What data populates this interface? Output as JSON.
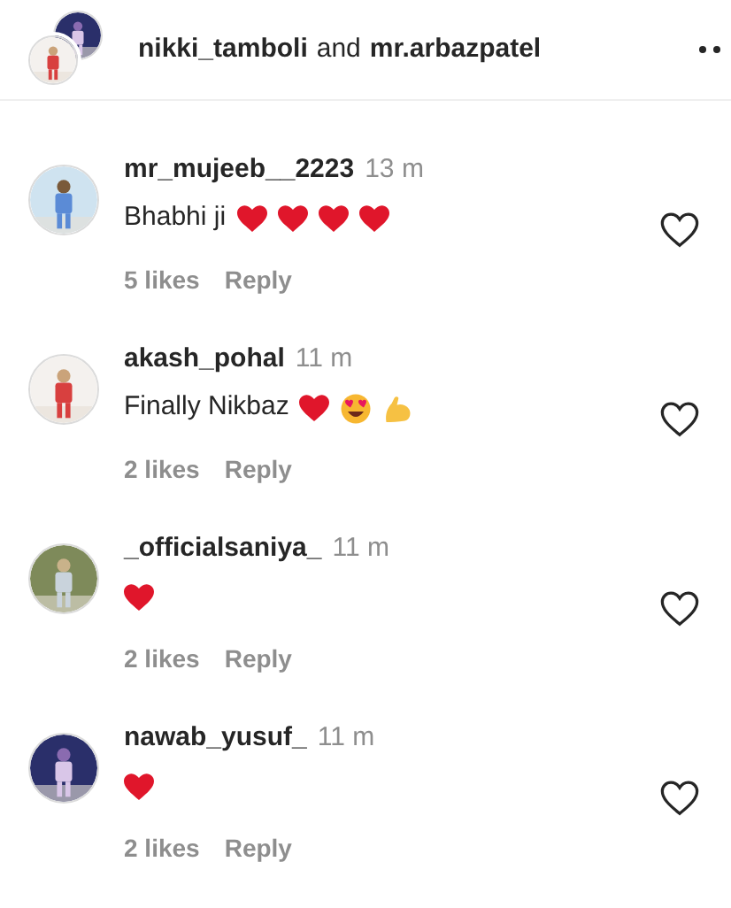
{
  "header": {
    "users": [
      "nikki_tamboli",
      "mr.arbazpatel"
    ],
    "joiner": "and"
  },
  "comments": [
    {
      "username": "mr_mujeeb__2223",
      "time": "13 m",
      "text": "Bhabhi ji",
      "emojis": [
        {
          "kind": "heart"
        },
        {
          "kind": "heart"
        },
        {
          "kind": "heart"
        },
        {
          "kind": "heart"
        }
      ],
      "likes": "5 likes",
      "reply": "Reply",
      "liked": false
    },
    {
      "username": "akash_pohal",
      "time": "11 m",
      "text": "Finally Nikbaz",
      "emojis": [
        {
          "kind": "heart"
        },
        {
          "kind": "heart-eyes"
        },
        {
          "kind": "flexed-biceps"
        }
      ],
      "likes": "2 likes",
      "reply": "Reply",
      "liked": false
    },
    {
      "username": "_officialsaniya_",
      "time": "11 m",
      "emojis": [
        {
          "kind": "heart"
        }
      ],
      "likes": "2 likes",
      "reply": "Reply",
      "liked": false
    },
    {
      "username": "nawab_yusuf_",
      "time": "11 m",
      "emojis": [
        {
          "kind": "heart"
        }
      ],
      "likes": "2 likes",
      "reply": "Reply",
      "liked": false
    }
  ]
}
